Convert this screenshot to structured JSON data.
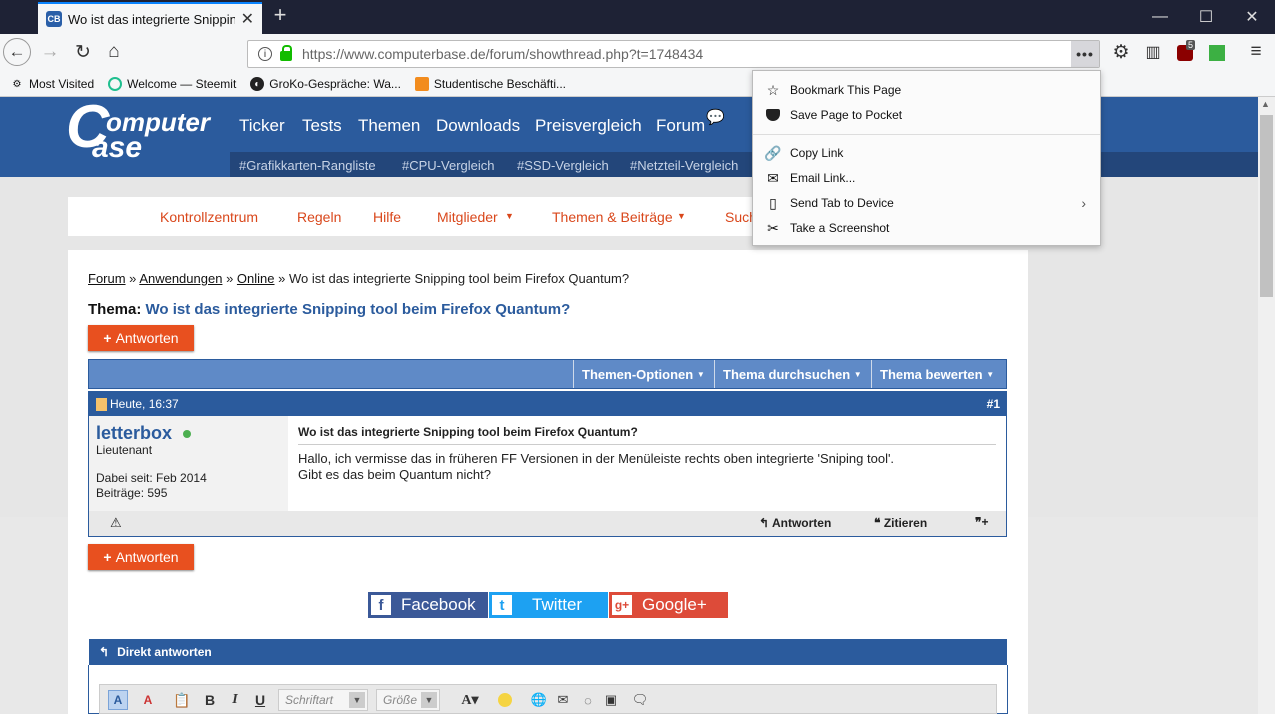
{
  "browser": {
    "tab_title": "Wo ist das integrierte Snipping",
    "tab_favicon": "CB",
    "url": "https://www.computerbase.de/forum/showthread.php?t=1748434",
    "ublock_count": "5",
    "bookmarks": [
      "Most Visited",
      "Welcome — Steemit",
      "GroKo-Gespräche: Wa...",
      "Studentische Beschäfti..."
    ]
  },
  "header": {
    "logo_line1": "omputer",
    "logo_c": "C",
    "logo_line2": "ase",
    "nav": [
      "Ticker",
      "Tests",
      "Themen",
      "Downloads",
      "Preisvergleich",
      "Forum"
    ],
    "tags": [
      "#Grafikkarten-Rangliste",
      "#CPU-Vergleich",
      "#SSD-Vergleich",
      "#Netzteil-Vergleich"
    ]
  },
  "forum_menu": [
    "Kontrollzentrum",
    "Regeln",
    "Hilfe",
    "Mitglieder",
    "Themen & Beiträge",
    "Such"
  ],
  "breadcrumb": {
    "items": [
      "Forum",
      "Anwendungen",
      "Online"
    ],
    "current": "Wo ist das integrierte Snipping tool beim Firefox Quantum?"
  },
  "thread": {
    "label": "Thema:",
    "title": "Wo ist das integrierte Snipping tool beim Firefox Quantum?",
    "reply_label": "Antworten",
    "options": [
      "Themen-Optionen",
      "Thema durchsuchen",
      "Thema bewerten"
    ]
  },
  "post": {
    "time": "Heute, 16:37",
    "number": "#1",
    "username": "letterbox",
    "rank": "Lieutenant",
    "joined": "Dabei seit: Feb 2014",
    "posts": "Beiträge: 595",
    "title": "Wo ist das integrierte Snipping tool beim Firefox Quantum?",
    "body_line1": "Hallo, ich vermisse das in früheren FF Versionen in der Menüleiste rechts oben integrierte 'Sniping tool'.",
    "body_line2": "Gibt es das beim Quantum nicht?",
    "action_reply": "Antworten",
    "action_quote": "Zitieren"
  },
  "share": {
    "facebook": "Facebook",
    "twitter": "Twitter",
    "google": "Google+"
  },
  "quick_reply": {
    "title": "Direkt antworten",
    "font_placeholder": "Schriftart",
    "size_placeholder": "Größe"
  },
  "page_actions_panel": {
    "items": [
      "Bookmark This Page",
      "Save Page to Pocket",
      "Copy Link",
      "Email Link...",
      "Send Tab to Device",
      "Take a Screenshot"
    ]
  },
  "colors": {
    "brand_blue": "#2b5b9d",
    "accent_orange": "#e8501f",
    "facebook": "#3b5998",
    "twitter": "#1da1f2",
    "google": "#dd4b39"
  }
}
